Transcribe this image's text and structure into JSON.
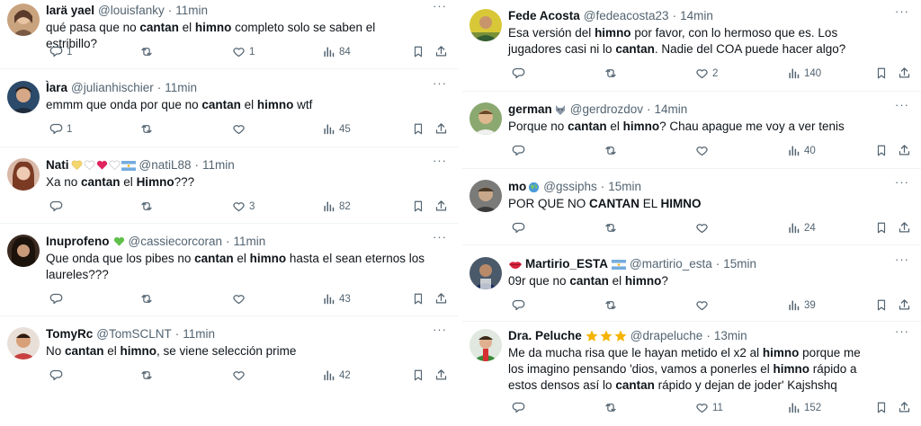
{
  "left_column": [
    {
      "name": "larä yael",
      "handle": "@louisfanky",
      "time": "11min",
      "text_parts": [
        {
          "t": "qué pasa que no ",
          "b": false
        },
        {
          "t": "cantan",
          "b": true
        },
        {
          "t": " el ",
          "b": false
        },
        {
          "t": "himno",
          "b": true
        },
        {
          "t": " completo solo se saben el estribillo?",
          "b": false
        }
      ],
      "replies": "1",
      "retweets": "",
      "likes": "1",
      "views": "84"
    },
    {
      "name": "Ìara",
      "handle": "@julianhischier",
      "time": "11min",
      "text_parts": [
        {
          "t": "emmm que onda por que no ",
          "b": false
        },
        {
          "t": "cantan",
          "b": true
        },
        {
          "t": " el ",
          "b": false
        },
        {
          "t": "himno",
          "b": true
        },
        {
          "t": " wtf",
          "b": false
        }
      ],
      "replies": "1",
      "retweets": "",
      "likes": "",
      "views": "45"
    },
    {
      "name": "Nati",
      "handle": "@natiL88",
      "time": "11min",
      "text_parts": [
        {
          "t": "Xa no ",
          "b": false
        },
        {
          "t": "cantan",
          "b": true
        },
        {
          "t": " el ",
          "b": false
        },
        {
          "t": "Himno",
          "b": true
        },
        {
          "t": "???",
          "b": false
        }
      ],
      "replies": "",
      "retweets": "",
      "likes": "3",
      "views": "82"
    },
    {
      "name": "Inuprofeno",
      "handle": "@cassiecorcoran",
      "time": "11min",
      "text_parts": [
        {
          "t": "Que onda que los pibes no ",
          "b": false
        },
        {
          "t": "cantan",
          "b": true
        },
        {
          "t": " el ",
          "b": false
        },
        {
          "t": "himno",
          "b": true
        },
        {
          "t": " hasta el sean eternos los laureles???",
          "b": false
        }
      ],
      "replies": "",
      "retweets": "",
      "likes": "",
      "views": "43"
    },
    {
      "name": "TomyRc",
      "handle": "@TomSCLNT",
      "time": "11min",
      "text_parts": [
        {
          "t": "No ",
          "b": false
        },
        {
          "t": "cantan",
          "b": true
        },
        {
          "t": " el ",
          "b": false
        },
        {
          "t": "himno",
          "b": true
        },
        {
          "t": ", se viene selección prime",
          "b": false
        }
      ],
      "replies": "",
      "retweets": "",
      "likes": "",
      "views": "42"
    }
  ],
  "right_column": [
    {
      "name": "Fede Acosta",
      "handle": "@fedeacosta23",
      "time": "14min",
      "text_parts": [
        {
          "t": "Esa versión del ",
          "b": false
        },
        {
          "t": "himno",
          "b": true
        },
        {
          "t": " por favor, con lo hermoso que es. Los jugadores casi ni lo ",
          "b": false
        },
        {
          "t": "cantan",
          "b": true
        },
        {
          "t": ". Nadie del COA puede hacer algo?",
          "b": false
        }
      ],
      "replies": "",
      "retweets": "",
      "likes": "2",
      "views": "140"
    },
    {
      "name": "german",
      "handle": "@gerdrozdov",
      "time": "14min",
      "text_parts": [
        {
          "t": "Porque no ",
          "b": false
        },
        {
          "t": "cantan",
          "b": true
        },
        {
          "t": " el ",
          "b": false
        },
        {
          "t": "himno",
          "b": true
        },
        {
          "t": "? Chau apague me voy a ver tenis",
          "b": false
        }
      ],
      "replies": "",
      "retweets": "",
      "likes": "",
      "views": "40"
    },
    {
      "name": "mo",
      "handle": "@gssiphs",
      "time": "15min",
      "text_parts": [
        {
          "t": "POR QUE NO ",
          "b": false
        },
        {
          "t": "CANTAN",
          "b": true
        },
        {
          "t": " EL ",
          "b": false
        },
        {
          "t": "HIMNO",
          "b": true
        }
      ],
      "replies": "",
      "retweets": "",
      "likes": "",
      "views": "24"
    },
    {
      "name": "Martirio_ESTA",
      "handle": "@martirio_esta",
      "time": "15min",
      "text_parts": [
        {
          "t": "09r que no ",
          "b": false
        },
        {
          "t": "cantan",
          "b": true
        },
        {
          "t": " el ",
          "b": false
        },
        {
          "t": "himno",
          "b": true
        },
        {
          "t": "?",
          "b": false
        }
      ],
      "replies": "",
      "retweets": "",
      "likes": "",
      "views": "39"
    },
    {
      "name": "Dra. Peluche",
      "handle": "@drapeluche",
      "time": "13min",
      "text_parts": [
        {
          "t": "Me da mucha risa que le hayan metido el x2 al ",
          "b": false
        },
        {
          "t": "himno",
          "b": true
        },
        {
          "t": " porque me los imagino pensando 'dios, vamos a ponerles el ",
          "b": false
        },
        {
          "t": "himno",
          "b": true
        },
        {
          "t": " rápido a estos densos así lo ",
          "b": false
        },
        {
          "t": "cantan",
          "b": true
        },
        {
          "t": " rápido y dejan de joder' Kajshshq",
          "b": false
        }
      ],
      "replies": "",
      "retweets": "",
      "likes": "11",
      "views": "152"
    }
  ],
  "icons": {
    "reply": "reply-icon",
    "retweet": "retweet-icon",
    "like": "heart-icon",
    "views": "views-icon",
    "bookmark": "bookmark-icon",
    "share": "share-icon",
    "more": "more-icon"
  },
  "colors": {
    "text": "#0f1419",
    "secondary": "#536471",
    "divider": "#eff3f4"
  }
}
